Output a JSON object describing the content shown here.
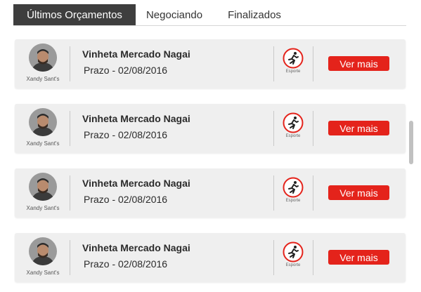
{
  "tabs": [
    {
      "label": "Últimos Orçamentos",
      "active": true
    },
    {
      "label": "Negociando",
      "active": false
    },
    {
      "label": "Finalizados",
      "active": false
    }
  ],
  "cards": [
    {
      "author": "Xandy Sant's",
      "title": "Vinheta Mercado Nagai",
      "deadline": "Prazo - 02/08/2016",
      "category": "Esporte",
      "category_icon": "running-person-icon",
      "button": "Ver mais"
    },
    {
      "author": "Xandy Sant's",
      "title": "Vinheta Mercado Nagai",
      "deadline": "Prazo - 02/08/2016",
      "category": "Esporte",
      "category_icon": "running-person-icon",
      "button": "Ver mais"
    },
    {
      "author": "Xandy Sant's",
      "title": "Vinheta Mercado Nagai",
      "deadline": "Prazo - 02/08/2016",
      "category": "Esporte",
      "category_icon": "running-person-icon",
      "button": "Ver mais"
    },
    {
      "author": "Xandy Sant's",
      "title": "Vinheta Mercado Nagai",
      "deadline": "Prazo - 02/08/2016",
      "category": "Esporte",
      "category_icon": "running-person-icon",
      "button": "Ver mais"
    }
  ],
  "colors": {
    "accent": "#e4231b",
    "active_tab": "#3e3e3e",
    "card_bg": "#efefef"
  }
}
